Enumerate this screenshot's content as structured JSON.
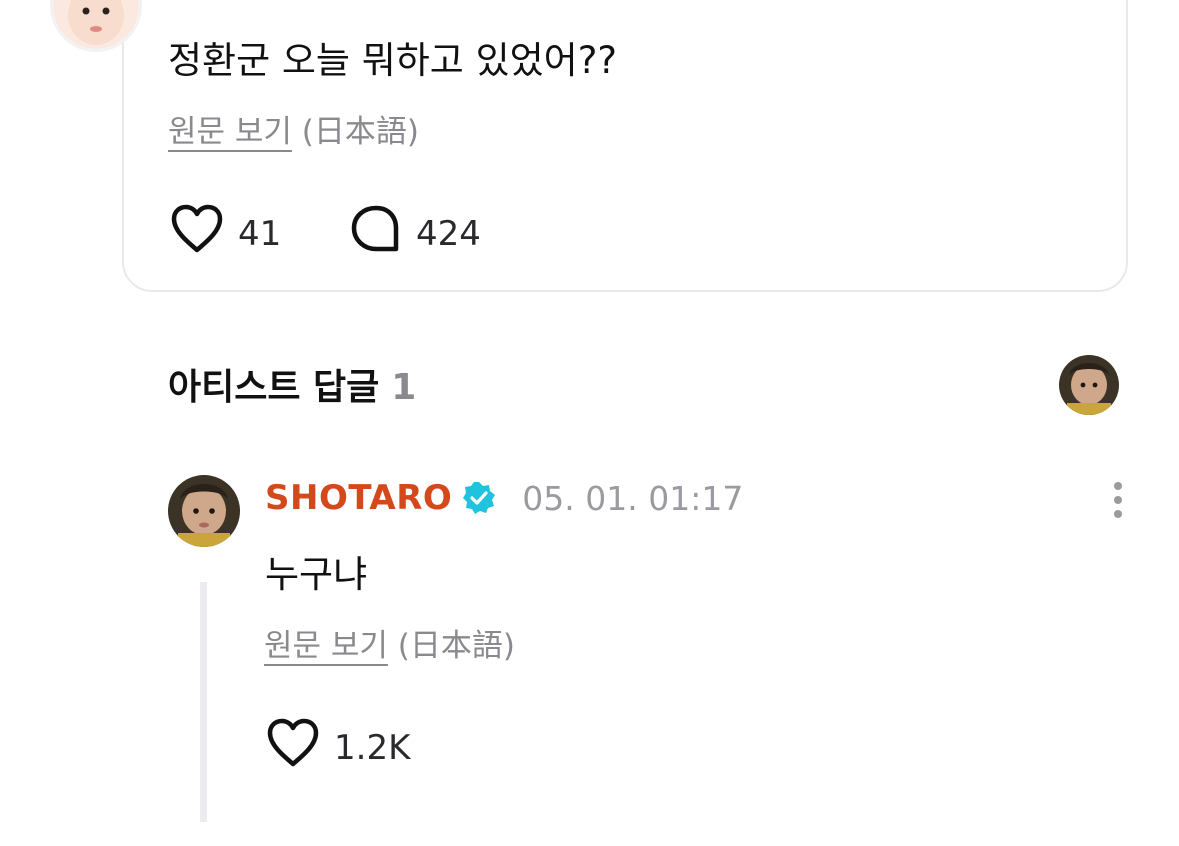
{
  "post": {
    "text": "정환군 오늘 뭐하고 있었어??",
    "translate": {
      "link_label": "원문 보기",
      "language": "(日本語)"
    },
    "likes": "41",
    "comments": "424"
  },
  "artist_replies": {
    "title": "아티스트 답글",
    "count": "1"
  },
  "reply": {
    "author": "SHOTARO",
    "timestamp": "05. 01. 01:17",
    "text": "누구냐",
    "translate": {
      "link_label": "원문 보기",
      "language": "(日本語)"
    },
    "likes": "1.2K"
  },
  "colors": {
    "author_name": "#d4491b",
    "verified_badge": "#1fc3de",
    "muted_text": "#8a8a8e",
    "thread_line": "#ececf0"
  },
  "icons": {
    "like": "heart-icon",
    "comment": "comment-bubble-icon",
    "verified": "verified-badge-icon",
    "more": "more-vertical-icon"
  }
}
